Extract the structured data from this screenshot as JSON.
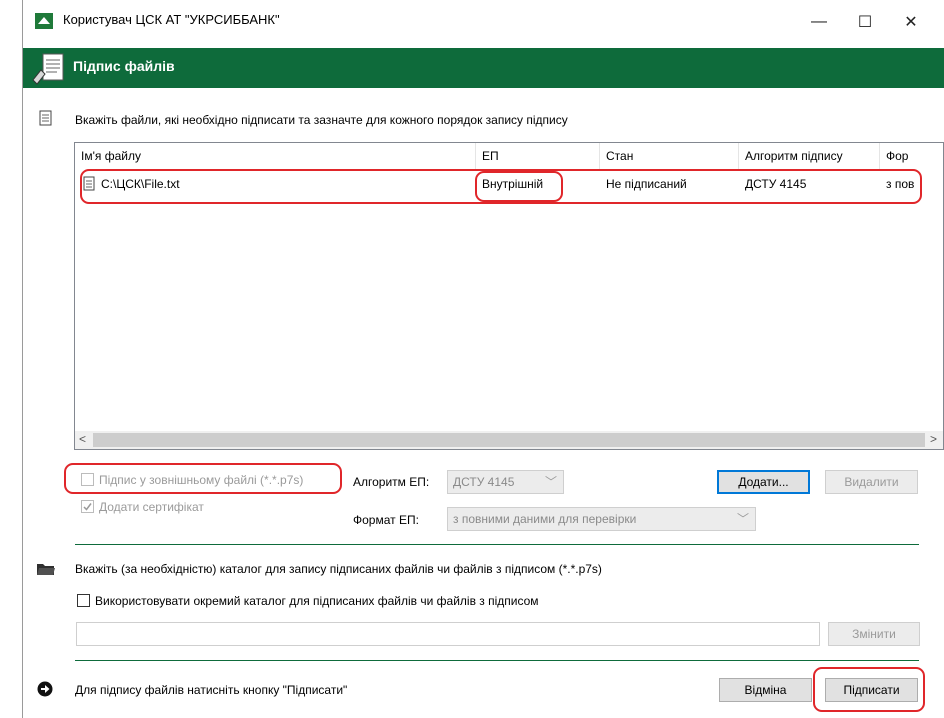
{
  "window": {
    "title": "Користувач ЦСК АТ \"УКРСИББАНК\"",
    "minimize": "—",
    "maximize": "☐",
    "close": "✕"
  },
  "header": {
    "title": "Підпис файлів"
  },
  "files_section": {
    "instruction": "Вкажіть файли, які необхідно підписати та зазначте для кожного порядок запису підпису",
    "columns": [
      "Ім'я файлу",
      "ЕП",
      "Стан",
      "Алгоритм підпису",
      "Фор"
    ],
    "rows": [
      {
        "name": "C:\\ЦСК\\File.txt",
        "ep": "Внутрішній",
        "status": "Не підписаний",
        "algorithm": "ДСТУ 4145",
        "format": "з пов"
      }
    ],
    "scroll_left": "<",
    "scroll_right": ">"
  },
  "options": {
    "external_file_label": "Підпис у зовнішньому файлі (*.*.p7s)",
    "add_certificate_label": "Додати сертифікат",
    "algorithm_label": "Алгоритм ЕП:",
    "algorithm_value": "ДСТУ 4145",
    "format_label": "Формат ЕП:",
    "format_value": "з повними даними для перевірки",
    "add_button": "Додати...",
    "remove_button": "Видалити"
  },
  "catalog_section": {
    "instruction": "Вкажіть (за необхідністю) каталог для запису підписаних файлів чи файлів з підписом (*.*.p7s)",
    "separate_catalog_label": "Використовувати окремий каталог для підписаних файлів чи файлів з підписом",
    "path_value": "",
    "change_button": "Змінити"
  },
  "footer": {
    "hint": "Для підпису файлів натисніть кнопку \"Підписати\"",
    "cancel_button": "Відміна",
    "sign_button": "Підписати"
  },
  "colors": {
    "header_green": "#0e6b3b",
    "highlight_red": "#e0262a",
    "focus_blue": "#0078d7"
  }
}
